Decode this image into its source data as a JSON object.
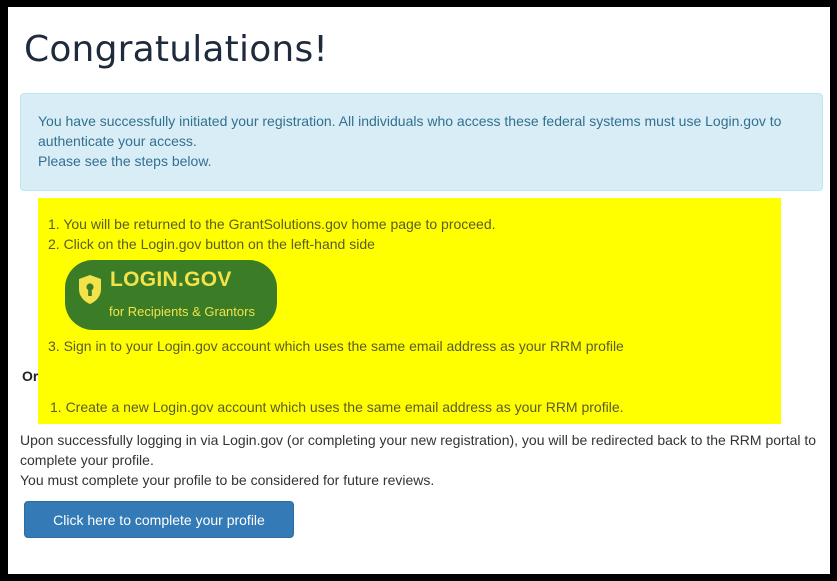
{
  "page": {
    "title": "Congratulations!"
  },
  "info_alert": {
    "line1": "You have successfully initiated your registration. All individuals who access these federal systems must use Login.gov to authenticate your access.",
    "line2": "Please see the steps below."
  },
  "steps": {
    "step1": "1. You will be returned to the GrantSolutions.gov home page to proceed.",
    "step2": "2. Click on the Login.gov button on the left-hand side",
    "login_button": {
      "title": "LOGIN.GOV",
      "subtitle": "for Recipients & Grantors"
    },
    "step3": "3. Sign in to your Login.gov account which uses the same email address as your RRM profile",
    "or_label": "Or",
    "alt_step": "1. Create a new Login.gov account which uses the same email address as your RRM profile."
  },
  "after": {
    "line1": "Upon successfully logging in via Login.gov (or completing your new registration), you will be redirected back to the RRM portal to complete your profile.",
    "line2": "You must complete your profile to be considered for future reviews."
  },
  "cta": {
    "label": "Click here to complete your profile"
  },
  "colors": {
    "info_bg": "#d9edf7",
    "highlight": "#ffff00",
    "login_green": "#3a7d26",
    "login_yellow": "#f3e24a",
    "primary_button": "#337ab7"
  }
}
